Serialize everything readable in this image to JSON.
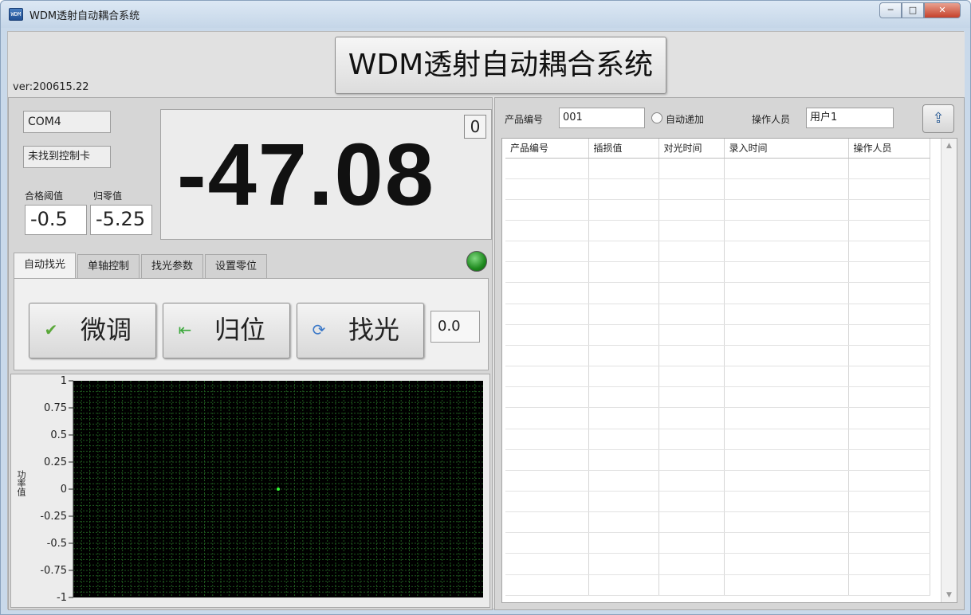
{
  "window": {
    "title": "WDM透射自动耦合系统",
    "app_icon_text": "WDM",
    "minimize_glyph": "─",
    "maximize_glyph": "□",
    "close_glyph": "✕"
  },
  "header": {
    "main_title": "WDM透射自动耦合系统",
    "version": "ver:200615.22"
  },
  "status": {
    "port": "COM4",
    "card_status": "未找到控制卡",
    "threshold_label": "合格阈值",
    "threshold_value": "-0.5",
    "zero_label": "归零值",
    "zero_value": "-5.25",
    "power_value": "-47.08",
    "counter": "0",
    "led_color": "#2e9a2e"
  },
  "tabs": [
    {
      "label": "自动找光",
      "active": true
    },
    {
      "label": "单轴控制",
      "active": false
    },
    {
      "label": "找光参数",
      "active": false
    },
    {
      "label": "设置零位",
      "active": false
    }
  ],
  "actions": {
    "fine_tune": {
      "label": "微调",
      "icon": "checkmark-icon"
    },
    "home": {
      "label": "归位",
      "icon": "home-arrow-icon"
    },
    "find_light": {
      "label": "找光",
      "icon": "refresh-icon"
    },
    "offset_value": "0.0"
  },
  "chart_data": {
    "type": "scatter",
    "title": "",
    "xlabel": "",
    "ylabel": "功率值",
    "ylim": [
      -1,
      1
    ],
    "y_ticks": [
      "1",
      "0.75",
      "0.5",
      "0.25",
      "0",
      "-0.25",
      "-0.5",
      "-0.75",
      "-1"
    ],
    "x_tick_labels_visible": false,
    "grid": true,
    "background": "#000000",
    "grid_color": "#1f5a1f",
    "point_color": "#33ff33",
    "points": [
      {
        "x": 0.5,
        "y": 0
      }
    ]
  },
  "record": {
    "product_no_label": "产品编号",
    "product_no_value": "001",
    "auto_increment_label": "自动递加",
    "operator_label": "操作人员",
    "operator_value": "用户1",
    "export_icon": "export-icon"
  },
  "table": {
    "columns": [
      "产品编号",
      "插损值",
      "对光时间",
      "录入时间",
      "操作人员"
    ],
    "rows": []
  },
  "scrollbar": {
    "up_glyph": "▲",
    "down_glyph": "▼"
  }
}
